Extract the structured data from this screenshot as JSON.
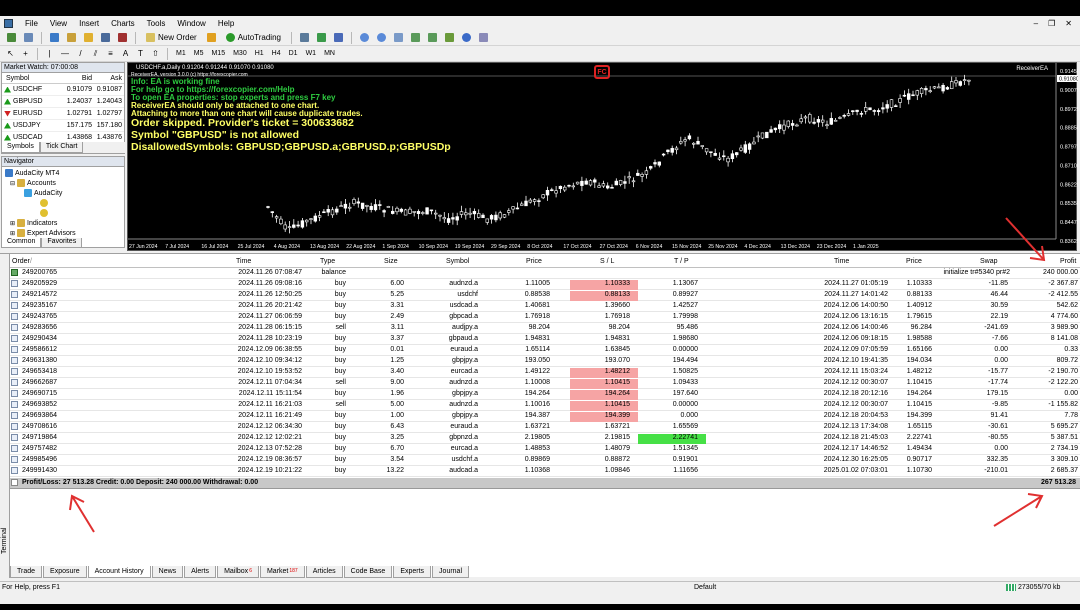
{
  "menu": [
    "File",
    "View",
    "Insert",
    "Charts",
    "Tools",
    "Window",
    "Help"
  ],
  "toolbar": {
    "new_order": "New Order",
    "autotrading": "AutoTrading",
    "timeframes": [
      "M1",
      "M5",
      "M15",
      "M30",
      "H1",
      "H4",
      "D1",
      "W1",
      "MN"
    ]
  },
  "market_watch": {
    "title": "Market Watch: 07:00:08",
    "cols": [
      "Symbol",
      "Bid",
      "Ask"
    ],
    "rows": [
      {
        "symbol": "USDCHF",
        "bid": "0.91079",
        "ask": "0.91087",
        "dir": "up"
      },
      {
        "symbol": "GBPUSD",
        "bid": "1.24037",
        "ask": "1.24043",
        "dir": "up"
      },
      {
        "symbol": "EURUSD",
        "bid": "1.02791",
        "ask": "1.02797",
        "dir": "down"
      },
      {
        "symbol": "USDJPY",
        "bid": "157.175",
        "ask": "157.180",
        "dir": "up"
      },
      {
        "symbol": "USDCAD",
        "bid": "1.43868",
        "ask": "1.43876",
        "dir": "up"
      }
    ],
    "tabs": [
      "Symbols",
      "Tick Chart"
    ]
  },
  "navigator": {
    "title": "Navigator",
    "root": "AudaCity MT4",
    "accounts": "Accounts",
    "account": "AudaCity",
    "indicators": "Indicators",
    "experts": "Expert Advisors",
    "tabs": [
      "Common",
      "Favorites"
    ]
  },
  "chart": {
    "symbol_line": "USDCHF.a,Daily  0.91204 0.91244 0.91070 0.91080",
    "ea_version": "ReceiverEA, version 3.0.0 (c) https://forexcopier.com",
    "ea_name": "ReceiverEA",
    "logo": "FC",
    "messages": [
      {
        "text": "Info: EA is working fine",
        "color": "#2ecc40",
        "size": "small"
      },
      {
        "text": "For help go to https://forexcopier.com/Help",
        "color": "#2ecc40",
        "size": "small"
      },
      {
        "text": "To open EA properties: stop experts and press F7 key",
        "color": "#2ecc40",
        "size": "small"
      },
      {
        "text": "ReceiverEA should only be attached to one chart.",
        "color": "#ffff66",
        "size": "small"
      },
      {
        "text": "Attaching to more than one chart will cause duplicate trades.",
        "color": "#ffff66",
        "size": "small"
      },
      {
        "text": "Order skipped. Provider's ticket = 300633682",
        "color": "#ffff66",
        "size": "big"
      },
      {
        "text": "Symbol \"GBPUSD\" is not allowed",
        "color": "#ffff66",
        "size": "big"
      },
      {
        "text": "DisallowedSymbols: GBPUSD;GBPUSD.a;GBPUSD.p;GBPUSDp",
        "color": "#ffff66",
        "size": "big"
      }
    ],
    "price_labels": [
      "0.91450",
      "0.90075",
      "0.89725",
      "0.88850",
      "0.87975",
      "0.87100",
      "0.86225",
      "0.85350",
      "0.84475",
      "0.83625"
    ],
    "last_price": "0.91080",
    "date_labels": [
      "27 Jun 2024",
      "7 Jul 2024",
      "16 Jul 2024",
      "25 Jul 2024",
      "4 Aug 2024",
      "13 Aug 2024",
      "22 Aug 2024",
      "1 Sep 2024",
      "10 Sep 2024",
      "19 Sep 2024",
      "29 Sep 2024",
      "8 Oct 2024",
      "17 Oct 2024",
      "27 Oct 2024",
      "6 Nov 2024",
      "15 Nov 2024",
      "25 Nov 2024",
      "4 Dec 2024",
      "13 Dec 2024",
      "23 Dec 2024",
      "1 Jan 2025"
    ]
  },
  "history": {
    "headers": [
      "Order",
      "Time",
      "Type",
      "Size",
      "Symbol",
      "Price",
      "S / L",
      "T / P",
      "Time",
      "Price",
      "Swap",
      "Profit"
    ],
    "rows": [
      {
        "order": "249200765",
        "time": "2024.11.26 07:08:47",
        "type": "balance",
        "size": "",
        "symbol": "",
        "price": "",
        "sl": "",
        "tp": "",
        "ctime": "",
        "cprice": "",
        "swap": "initialize tr#5340 pr#2",
        "profit": "240 000.00",
        "slhl": "",
        "tphl": "",
        "bal": true
      },
      {
        "order": "249205929",
        "time": "2024.11.26 09:08:16",
        "type": "buy",
        "size": "6.00",
        "symbol": "audnzd.a",
        "price": "1.11005",
        "sl": "1.10333",
        "tp": "1.13067",
        "ctime": "2024.11.27 01:05:19",
        "cprice": "1.10333",
        "swap": "-11.85",
        "profit": "-2 367.87",
        "slhl": "red",
        "tphl": ""
      },
      {
        "order": "249214572",
        "time": "2024.11.26 12:50:25",
        "type": "buy",
        "size": "5.25",
        "symbol": "usdchf",
        "price": "0.88538",
        "sl": "0.88133",
        "tp": "0.89927",
        "ctime": "2024.11.27 14:01:42",
        "cprice": "0.88133",
        "swap": "46.44",
        "profit": "-2 412.55",
        "slhl": "red",
        "tphl": ""
      },
      {
        "order": "249235167",
        "time": "2024.11.26 20:21:42",
        "type": "buy",
        "size": "3.31",
        "symbol": "usdcad.a",
        "price": "1.40681",
        "sl": "1.39660",
        "tp": "1.42527",
        "ctime": "2024.12.06 14:00:50",
        "cprice": "1.40912",
        "swap": "30.59",
        "profit": "542.62",
        "slhl": "",
        "tphl": ""
      },
      {
        "order": "249243765",
        "time": "2024.11.27 06:06:59",
        "type": "buy",
        "size": "2.49",
        "symbol": "gbpcad.a",
        "price": "1.76918",
        "sl": "1.76918",
        "tp": "1.79998",
        "ctime": "2024.12.06 13:16:15",
        "cprice": "1.79615",
        "swap": "22.19",
        "profit": "4 774.60",
        "slhl": "",
        "tphl": ""
      },
      {
        "order": "249283656",
        "time": "2024.11.28 06:15:15",
        "type": "sell",
        "size": "3.11",
        "symbol": "audjpy.a",
        "price": "98.204",
        "sl": "98.204",
        "tp": "95.486",
        "ctime": "2024.12.06 14:00:46",
        "cprice": "96.284",
        "swap": "-241.69",
        "profit": "3 989.90",
        "slhl": "",
        "tphl": ""
      },
      {
        "order": "249290434",
        "time": "2024.11.28 10:23:19",
        "type": "buy",
        "size": "3.37",
        "symbol": "gbpaud.a",
        "price": "1.94831",
        "sl": "1.94831",
        "tp": "1.98680",
        "ctime": "2024.12.06 09:18:15",
        "cprice": "1.98588",
        "swap": "-7.66",
        "profit": "8 141.08",
        "slhl": "",
        "tphl": ""
      },
      {
        "order": "249586612",
        "time": "2024.12.09 06:38:55",
        "type": "buy",
        "size": "0.01",
        "symbol": "euraud.a",
        "price": "1.65114",
        "sl": "1.63845",
        "tp": "0.00000",
        "ctime": "2024.12.09 07:05:59",
        "cprice": "1.65166",
        "swap": "0.00",
        "profit": "0.33",
        "slhl": "",
        "tphl": ""
      },
      {
        "order": "249631380",
        "time": "2024.12.10 09:34:12",
        "type": "buy",
        "size": "1.25",
        "symbol": "gbpjpy.a",
        "price": "193.050",
        "sl": "193.070",
        "tp": "194.494",
        "ctime": "2024.12.10 19:41:35",
        "cprice": "194.034",
        "swap": "0.00",
        "profit": "809.72",
        "slhl": "",
        "tphl": ""
      },
      {
        "order": "249653418",
        "time": "2024.12.10 19:53:52",
        "type": "buy",
        "size": "3.40",
        "symbol": "eurcad.a",
        "price": "1.49122",
        "sl": "1.48212",
        "tp": "1.50825",
        "ctime": "2024.12.11 15:03:24",
        "cprice": "1.48212",
        "swap": "-15.77",
        "profit": "-2 190.70",
        "slhl": "red",
        "tphl": ""
      },
      {
        "order": "249662687",
        "time": "2024.12.11 07:04:34",
        "type": "sell",
        "size": "9.00",
        "symbol": "audnzd.a",
        "price": "1.10008",
        "sl": "1.10415",
        "tp": "1.09433",
        "ctime": "2024.12.12 00:30:07",
        "cprice": "1.10415",
        "swap": "-17.74",
        "profit": "-2 122.20",
        "slhl": "red",
        "tphl": ""
      },
      {
        "order": "249690715",
        "time": "2024.12.11 15:11:54",
        "type": "buy",
        "size": "1.96",
        "symbol": "gbpjpy.a",
        "price": "194.264",
        "sl": "194.264",
        "tp": "197.640",
        "ctime": "2024.12.18 20:12:16",
        "cprice": "194.264",
        "swap": "179.15",
        "profit": "0.00",
        "slhl": "red",
        "tphl": ""
      },
      {
        "order": "249693852",
        "time": "2024.12.11 16:21:03",
        "type": "sell",
        "size": "5.00",
        "symbol": "audnzd.a",
        "price": "1.10016",
        "sl": "1.10415",
        "tp": "0.00000",
        "ctime": "2024.12.12 00:30:07",
        "cprice": "1.10415",
        "swap": "-9.85",
        "profit": "-1 155.82",
        "slhl": "red",
        "tphl": ""
      },
      {
        "order": "249693864",
        "time": "2024.12.11 16:21:49",
        "type": "buy",
        "size": "1.00",
        "symbol": "gbpjpy.a",
        "price": "194.387",
        "sl": "194.399",
        "tp": "0.000",
        "ctime": "2024.12.18 20:04:53",
        "cprice": "194.399",
        "swap": "91.41",
        "profit": "7.78",
        "slhl": "red",
        "tphl": ""
      },
      {
        "order": "249708616",
        "time": "2024.12.12 06:34:30",
        "type": "buy",
        "size": "6.43",
        "symbol": "euraud.a",
        "price": "1.63721",
        "sl": "1.63721",
        "tp": "1.65569",
        "ctime": "2024.12.13 17:34:08",
        "cprice": "1.65115",
        "swap": "-30.61",
        "profit": "5 695.27",
        "slhl": "",
        "tphl": ""
      },
      {
        "order": "249719864",
        "time": "2024.12.12 12:02:21",
        "type": "buy",
        "size": "3.25",
        "symbol": "gbpnzd.a",
        "price": "2.19805",
        "sl": "2.19815",
        "tp": "2.22741",
        "ctime": "2024.12.18 21:45:03",
        "cprice": "2.22741",
        "swap": "-80.55",
        "profit": "5 387.51",
        "slhl": "",
        "tphl": "green"
      },
      {
        "order": "249757482",
        "time": "2024.12.13 07:52:28",
        "type": "buy",
        "size": "6.70",
        "symbol": "eurcad.a",
        "price": "1.48853",
        "sl": "1.48079",
        "tp": "1.51345",
        "ctime": "2024.12.17 14:46:52",
        "cprice": "1.49434",
        "swap": "0.00",
        "profit": "2 734.19",
        "slhl": "",
        "tphl": ""
      },
      {
        "order": "249985496",
        "time": "2024.12.19 08:36:57",
        "type": "buy",
        "size": "3.54",
        "symbol": "usdchf.a",
        "price": "0.89869",
        "sl": "0.88872",
        "tp": "0.91901",
        "ctime": "2024.12.30 16:25:05",
        "cprice": "0.90717",
        "swap": "332.35",
        "profit": "3 309.10",
        "slhl": "",
        "tphl": ""
      },
      {
        "order": "249991430",
        "time": "2024.12.19 10:21:22",
        "type": "buy",
        "size": "13.22",
        "symbol": "audcad.a",
        "price": "1.10368",
        "sl": "1.09846",
        "tp": "1.11656",
        "ctime": "2025.01.02 07:03:01",
        "cprice": "1.10730",
        "swap": "-210.01",
        "profit": "2 685.37",
        "slhl": "",
        "tphl": ""
      }
    ],
    "summary": "Profit/Loss: 27 513.28  Credit: 0.00  Deposit: 240 000.00  Withdrawal: 0.00",
    "total": "267 513.28"
  },
  "terminal_label": "Terminal",
  "bottom_tabs": [
    {
      "label": "Trade",
      "badge": ""
    },
    {
      "label": "Exposure",
      "badge": ""
    },
    {
      "label": "Account History",
      "badge": "",
      "active": true
    },
    {
      "label": "News",
      "badge": ""
    },
    {
      "label": "Alerts",
      "badge": ""
    },
    {
      "label": "Mailbox",
      "badge": "6"
    },
    {
      "label": "Market",
      "badge": "187"
    },
    {
      "label": "Articles",
      "badge": ""
    },
    {
      "label": "Code Base",
      "badge": ""
    },
    {
      "label": "Experts",
      "badge": ""
    },
    {
      "label": "Journal",
      "badge": ""
    }
  ],
  "status": {
    "help": "For Help, press F1",
    "profile": "Default",
    "traffic": "273055/70 kb"
  },
  "colors": {
    "arrow": "#e03030",
    "sl_highlight": "#f6a4a4",
    "tp_highlight": "#46e046",
    "candle": "#ffffff"
  }
}
